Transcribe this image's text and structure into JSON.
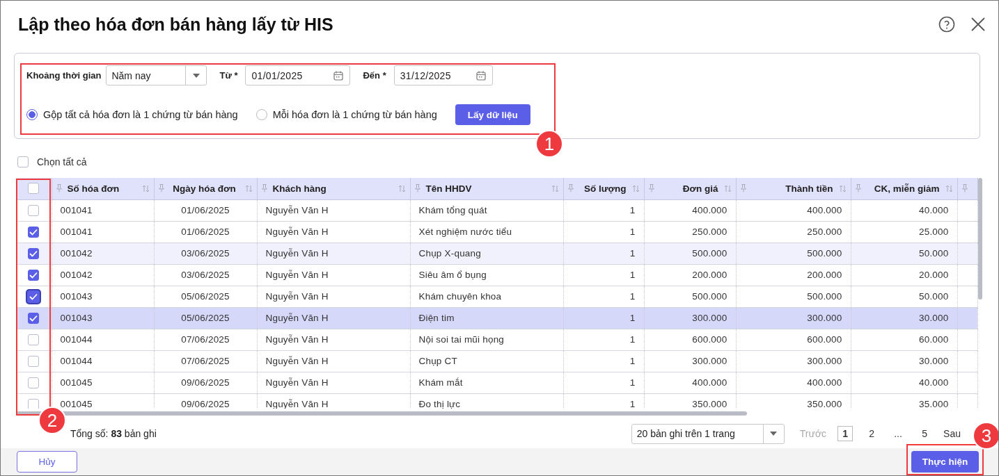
{
  "dialog": {
    "title": "Lập theo hóa đơn bán hàng lấy từ HIS"
  },
  "filters": {
    "period_label": "Khoảng thời gian",
    "period_value": "Năm nay",
    "from_label": "Từ *",
    "from_value": "01/01/2025",
    "to_label": "Đến *",
    "to_value": "31/12/2025",
    "options": [
      {
        "label": "Gộp tất cả hóa đơn là 1 chứng từ bán hàng",
        "selected": true
      },
      {
        "label": "Mỗi hóa đơn là 1 chứng từ bán hàng",
        "selected": false
      }
    ],
    "fetch_button": "Lấy dữ liệu"
  },
  "select_all": {
    "label": "Chọn tất cả",
    "checked": false
  },
  "table": {
    "columns": [
      {
        "label": "Số hóa đơn"
      },
      {
        "label": "Ngày hóa đơn"
      },
      {
        "label": "Khách hàng"
      },
      {
        "label": "Tên HHDV"
      },
      {
        "label": "Số lượng"
      },
      {
        "label": "Đơn giá"
      },
      {
        "label": "Thành tiền"
      },
      {
        "label": "CK, miễn giảm"
      }
    ],
    "header_checked": false,
    "rows": [
      {
        "checked": false,
        "selected": false,
        "hovered": false,
        "focused": false,
        "cells": [
          "001041",
          "01/06/2025",
          "Nguyễn Văn H",
          "Khám tổng quát",
          "1",
          "400.000",
          "400.000",
          "40.000"
        ]
      },
      {
        "checked": true,
        "selected": false,
        "hovered": false,
        "focused": false,
        "cells": [
          "001041",
          "01/06/2025",
          "Nguyễn Văn H",
          "Xét nghiệm nước tiểu",
          "1",
          "250.000",
          "250.000",
          "25.000"
        ]
      },
      {
        "checked": true,
        "selected": false,
        "hovered": true,
        "focused": false,
        "cells": [
          "001042",
          "03/06/2025",
          "Nguyễn Văn H",
          "Chụp X-quang",
          "1",
          "500.000",
          "500.000",
          "50.000"
        ]
      },
      {
        "checked": true,
        "selected": false,
        "hovered": false,
        "focused": false,
        "cells": [
          "001042",
          "03/06/2025",
          "Nguyễn Văn H",
          "Siêu âm ổ bụng",
          "1",
          "200.000",
          "200.000",
          "20.000"
        ]
      },
      {
        "checked": true,
        "selected": false,
        "hovered": false,
        "focused": true,
        "cells": [
          "001043",
          "05/06/2025",
          "Nguyễn Văn H",
          "Khám chuyên khoa",
          "1",
          "500.000",
          "500.000",
          "50.000"
        ]
      },
      {
        "checked": true,
        "selected": true,
        "hovered": false,
        "focused": false,
        "cells": [
          "001043",
          "05/06/2025",
          "Nguyễn Văn H",
          "Điện tim",
          "1",
          "300.000",
          "300.000",
          "30.000"
        ]
      },
      {
        "checked": false,
        "selected": false,
        "hovered": false,
        "focused": false,
        "cells": [
          "001044",
          "07/06/2025",
          "Nguyễn Văn H",
          "Nội soi tai mũi họng",
          "1",
          "600.000",
          "600.000",
          "60.000"
        ]
      },
      {
        "checked": false,
        "selected": false,
        "hovered": false,
        "focused": false,
        "cells": [
          "001044",
          "07/06/2025",
          "Nguyễn Văn H",
          "Chụp CT",
          "1",
          "300.000",
          "300.000",
          "30.000"
        ]
      },
      {
        "checked": false,
        "selected": false,
        "hovered": false,
        "focused": false,
        "cells": [
          "001045",
          "09/06/2025",
          "Nguyễn Văn H",
          "Khám mắt",
          "1",
          "400.000",
          "400.000",
          "40.000"
        ]
      },
      {
        "checked": false,
        "selected": false,
        "hovered": false,
        "focused": false,
        "cells": [
          "001045",
          "09/06/2025",
          "Nguyễn Văn H",
          "Đo thị lực",
          "1",
          "350.000",
          "350.000",
          "35.000"
        ]
      }
    ]
  },
  "footer": {
    "total": "Tổng số: **83** bản ghi",
    "page_size": "20 bản ghi trên 1 trang",
    "prev": {
      "label": "Trước",
      "disabled": true
    },
    "pages": [
      {
        "label": "1",
        "selected": true
      },
      {
        "label": "2",
        "selected": false
      },
      {
        "label": "...",
        "selected": false
      },
      {
        "label": "5",
        "selected": false
      }
    ],
    "next": {
      "label": "Sau",
      "disabled": false
    }
  },
  "actions": {
    "cancel": "Hủy",
    "submit": "Thực hiện"
  },
  "annotations": [
    {
      "number": "1"
    },
    {
      "number": "2"
    },
    {
      "number": "3"
    }
  ]
}
